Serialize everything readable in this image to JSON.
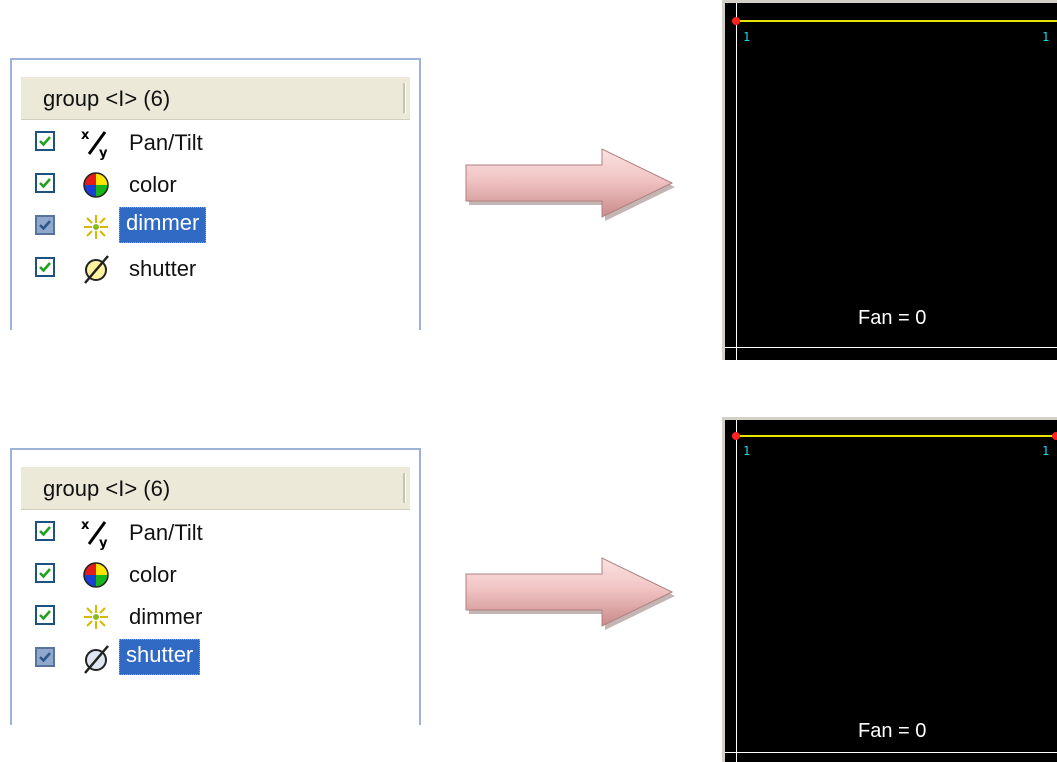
{
  "panels": [
    {
      "header": "group <I> (6)",
      "items": [
        {
          "label": "Pan/Tilt",
          "icon": "pan-tilt-icon",
          "checked": true,
          "selected": false
        },
        {
          "label": "color",
          "icon": "color-wheel-icon",
          "checked": true,
          "selected": false
        },
        {
          "label": "dimmer",
          "icon": "dimmer-icon",
          "checked": true,
          "selected": true
        },
        {
          "label": "shutter",
          "icon": "shutter-icon",
          "checked": true,
          "selected": false
        }
      ]
    },
    {
      "header": "group <I> (6)",
      "items": [
        {
          "label": "Pan/Tilt",
          "icon": "pan-tilt-icon",
          "checked": true,
          "selected": false
        },
        {
          "label": "color",
          "icon": "color-wheel-icon",
          "checked": true,
          "selected": false
        },
        {
          "label": "dimmer",
          "icon": "dimmer-icon",
          "checked": true,
          "selected": false
        },
        {
          "label": "shutter",
          "icon": "shutter-icon",
          "checked": true,
          "selected": true
        }
      ]
    }
  ],
  "screens": [
    {
      "left_tick": "1",
      "right_tick": "1",
      "fan_text": "Fan = 0"
    },
    {
      "left_tick": "1",
      "right_tick": "1",
      "fan_text": "Fan = 0"
    }
  ],
  "colors": {
    "selection": "#316ac5",
    "screen_bg": "#000000",
    "fan_line": "#e6e600",
    "endpoint": "#ff2020",
    "tick": "#22d3e6"
  }
}
